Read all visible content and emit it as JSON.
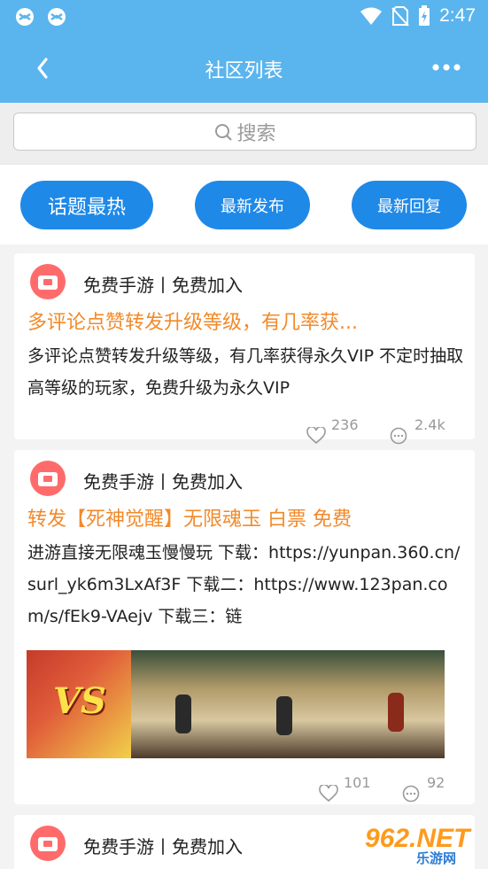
{
  "status_bar": {
    "time": "2:47"
  },
  "header": {
    "title": "社区列表"
  },
  "search": {
    "placeholder": "搜索"
  },
  "filters": [
    {
      "label": "话题最热"
    },
    {
      "label": "最新发布"
    },
    {
      "label": "最新回复"
    }
  ],
  "posts": [
    {
      "author": "免费手游丨免费加入",
      "title": "多评论点赞转发升级等级，有几率获...",
      "body": "多评论点赞转发升级等级，有几率获得永久VIP 不定时抽取高等级的玩家，免费升级为永久VIP",
      "likes": "236",
      "comments": "2.4k"
    },
    {
      "author": "免费手游丨免费加入",
      "title": "转发【死神觉醒】无限魂玉 白票 免费",
      "body": "进游直接无限魂玉慢慢玩 下载：https://yunpan.360.cn/surl_yk6m3LxAf3F 下载二：https://www.123pan.com/s/fEk9-VAejv 下载三：链",
      "likes": "101",
      "comments": "92",
      "image_text": "VS"
    },
    {
      "author": "免费手游丨免费加入"
    }
  ],
  "watermark": {
    "number": "962.NET",
    "site": "乐游网"
  },
  "colors": {
    "primary": "#5ab4ee",
    "button": "#1f89e8",
    "title_accent": "#f28a2a"
  }
}
